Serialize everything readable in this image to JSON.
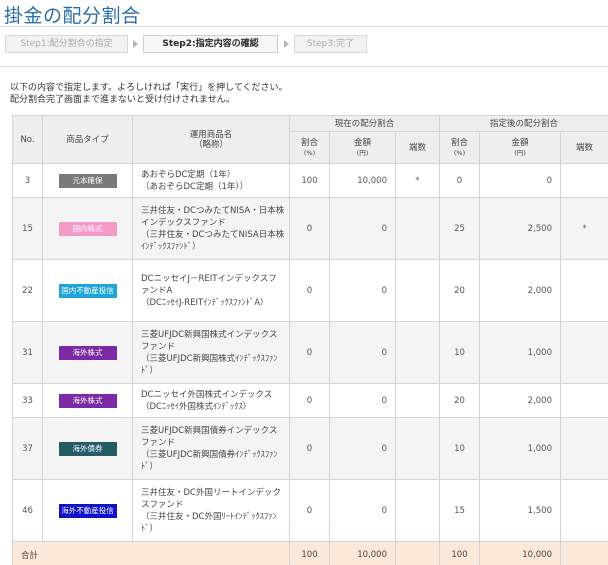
{
  "page": {
    "title": "掛金の配分割合"
  },
  "steps": [
    {
      "label": "Step1:配分割合の指定",
      "active": false
    },
    {
      "label": "Step2:指定内容の確認",
      "active": true
    },
    {
      "label": "Step3:完了",
      "active": false
    }
  ],
  "intro": {
    "line1": "以下の内容で指定します。よろしければ「実行」を押してください。",
    "line2": "配分割合完了画面まで進まないと受け付けされません。"
  },
  "table": {
    "headers": {
      "no": "No.",
      "type": "商品タイプ",
      "name_main": "運用商品名",
      "name_sub": "（略称）",
      "current": "現在の配分割合",
      "after": "指定後の配分割合",
      "ratio": "割合",
      "ratio_unit": "(%)",
      "amount": "金額",
      "amount_unit": "(円)",
      "fraction": "端数"
    },
    "rows": [
      {
        "no": "3",
        "type": "元本確保",
        "color": "#7a7a7a",
        "name": "あおぞらDC定期（1年）",
        "abbr": "（あおぞらDC定期（1年））",
        "cur_ratio": "100",
        "cur_amount": "10,000",
        "cur_frac": "*",
        "new_ratio": "0",
        "new_amount": "0",
        "new_frac": ""
      },
      {
        "no": "15",
        "type": "国内株式",
        "color": "#f59ac6",
        "name": "三井住友・DCつみたてNISA・日本株インデックスファンド",
        "abbr": "（三井住友・DCつみたてNISA日本株ｲﾝﾃﾞｯｸｽﾌｧﾝﾄﾞ）",
        "cur_ratio": "0",
        "cur_amount": "0",
        "cur_frac": "",
        "new_ratio": "25",
        "new_amount": "2,500",
        "new_frac": "*"
      },
      {
        "no": "22",
        "type": "国内不動産投信",
        "color": "#1ea4d8",
        "name": "DCニッセイJ－REITインデックスファンドA",
        "abbr": "（DCﾆｯｾｲJ-REITｲﾝﾃﾞｯｸｽﾌｧﾝﾄﾞA）",
        "cur_ratio": "0",
        "cur_amount": "0",
        "cur_frac": "",
        "new_ratio": "20",
        "new_amount": "2,000",
        "new_frac": ""
      },
      {
        "no": "31",
        "type": "海外株式",
        "color": "#7b2aa3",
        "name": "三菱UFJDC新興国株式インデックスファンド",
        "abbr": "（三菱UFJDC新興国株式ｲﾝﾃﾞｯｸｽﾌｧﾝﾄﾞ）",
        "cur_ratio": "0",
        "cur_amount": "0",
        "cur_frac": "",
        "new_ratio": "10",
        "new_amount": "1,000",
        "new_frac": ""
      },
      {
        "no": "33",
        "type": "海外株式",
        "color": "#7b2aa3",
        "name": "DCニッセイ外国株式インデックス",
        "abbr": "（DCﾆｯｾｲ外国株式ｲﾝﾃﾞｯｸｽ）",
        "cur_ratio": "0",
        "cur_amount": "0",
        "cur_frac": "",
        "new_ratio": "20",
        "new_amount": "2,000",
        "new_frac": ""
      },
      {
        "no": "37",
        "type": "海外債券",
        "color": "#245c66",
        "name": "三菱UFJDC新興国債券インデックスファンド",
        "abbr": "（三菱UFJDC新興国債券ｲﾝﾃﾞｯｸｽﾌｧﾝﾄﾞ）",
        "cur_ratio": "0",
        "cur_amount": "0",
        "cur_frac": "",
        "new_ratio": "10",
        "new_amount": "1,000",
        "new_frac": ""
      },
      {
        "no": "46",
        "type": "海外不動産投信",
        "color": "#1010c8",
        "name": "三井住友・DC外国リートインデックスファンド",
        "abbr": "（三井住友・DC外国ﾘｰﾄｲﾝﾃﾞｯｸｽﾌｧﾝﾄﾞ）",
        "cur_ratio": "0",
        "cur_amount": "0",
        "cur_frac": "",
        "new_ratio": "15",
        "new_amount": "1,500",
        "new_frac": ""
      }
    ],
    "total": {
      "label": "合計",
      "cur_ratio": "100",
      "cur_amount": "10,000",
      "new_ratio": "100",
      "new_amount": "10,000"
    }
  }
}
